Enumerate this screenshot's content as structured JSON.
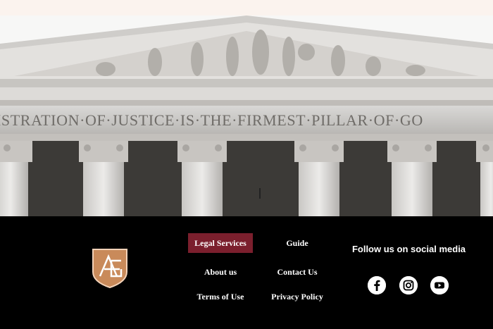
{
  "hero": {
    "inscription": "ISTRATION·OF·JUSTICE·IS·THE·FIRMEST·PILLAR·OF·GO"
  },
  "footer": {
    "nav": [
      {
        "label": "Legal Services",
        "active": true
      },
      {
        "label": "Guide",
        "active": false
      },
      {
        "label": "About us",
        "active": false
      },
      {
        "label": "Contact Us",
        "active": false
      },
      {
        "label": "Terms of Use",
        "active": false
      },
      {
        "label": "Privacy Policy",
        "active": false
      }
    ],
    "social_heading": "Follow us on social media",
    "social_icons": [
      "facebook-icon",
      "instagram-icon",
      "youtube-icon"
    ],
    "logo_icon": "shield-logo-icon"
  },
  "colors": {
    "active_nav": "#7b1f2d",
    "logo_copper": "#c98a5a",
    "footer_bg": "#000000",
    "top_bar": "#fbf3ee"
  }
}
